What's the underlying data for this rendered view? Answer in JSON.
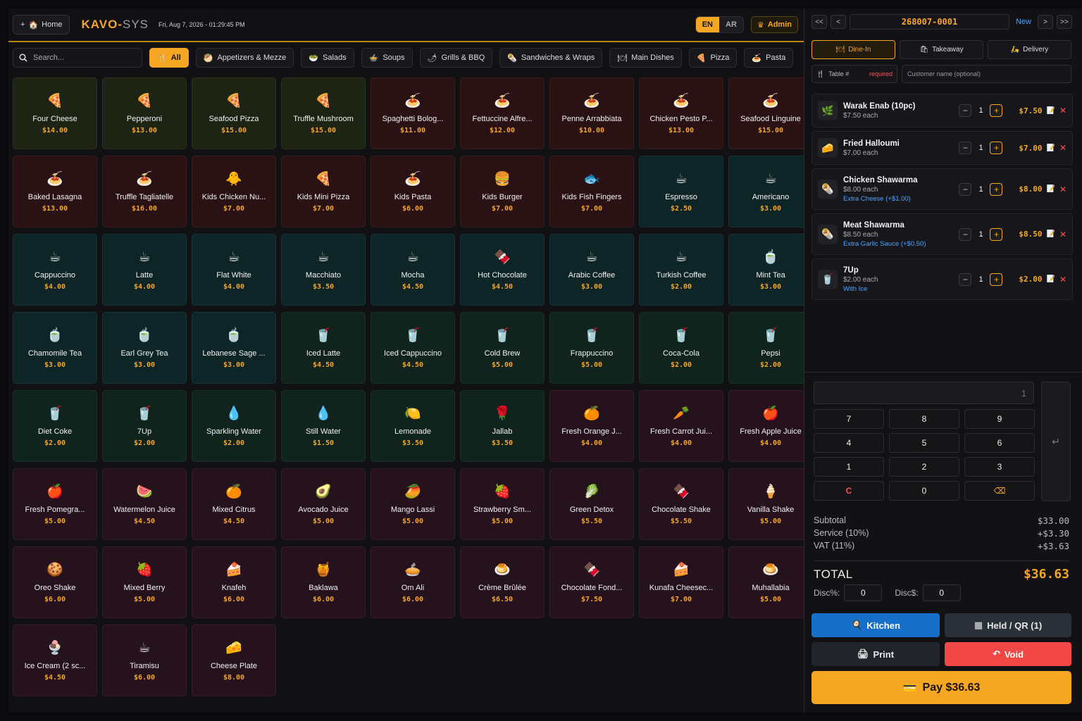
{
  "header": {
    "home_label": "Home",
    "logo_main": "KAVO-",
    "logo_sys": "SYS",
    "datetime": "Fri, Aug 7, 2026 - 01:29:45 PM",
    "lang_en": "EN",
    "lang_ar": "AR",
    "admin_label": "Admin"
  },
  "search": {
    "placeholder": "Search..."
  },
  "categories": [
    {
      "icon": "🍴",
      "label": "All",
      "active": true
    },
    {
      "icon": "🥙",
      "label": "Appetizers & Mezze"
    },
    {
      "icon": "🥗",
      "label": "Salads"
    },
    {
      "icon": "🍲",
      "label": "Soups"
    },
    {
      "icon": "🌶",
      "label": "Grills & BBQ"
    },
    {
      "icon": "🌯",
      "label": "Sandwiches & Wraps"
    },
    {
      "icon": "🍽",
      "label": "Main Dishes"
    },
    {
      "icon": "🍕",
      "label": "Pizza"
    },
    {
      "icon": "🍝",
      "label": "Pasta"
    }
  ],
  "products": [
    {
      "icon": "🍕",
      "name": "Four Cheese",
      "price": "$14.00",
      "tone": "olive"
    },
    {
      "icon": "🍕",
      "name": "Pepperoni",
      "price": "$13.00",
      "tone": "olive"
    },
    {
      "icon": "🍕",
      "name": "Seafood Pizza",
      "price": "$15.00",
      "tone": "olive"
    },
    {
      "icon": "🍕",
      "name": "Truffle Mushroom",
      "price": "$15.00",
      "tone": "olive"
    },
    {
      "icon": "🍝",
      "name": "Spaghetti Bolog...",
      "price": "$11.00",
      "tone": "maroon"
    },
    {
      "icon": "🍝",
      "name": "Fettuccine Alfre...",
      "price": "$12.00",
      "tone": "maroon"
    },
    {
      "icon": "🍝",
      "name": "Penne Arrabbiata",
      "price": "$10.00",
      "tone": "maroon"
    },
    {
      "icon": "🍝",
      "name": "Chicken Pesto P...",
      "price": "$13.00",
      "tone": "maroon"
    },
    {
      "icon": "🍝",
      "name": "Seafood Linguine",
      "price": "$15.00",
      "tone": "maroon"
    },
    {
      "icon": "🍝",
      "name": "Baked Lasagna",
      "price": "$13.00",
      "tone": "maroon"
    },
    {
      "icon": "🍝",
      "name": "Truffle Tagliatelle",
      "price": "$16.00",
      "tone": "maroon"
    },
    {
      "icon": "🐥",
      "name": "Kids Chicken Nu...",
      "price": "$7.00",
      "tone": "maroon"
    },
    {
      "icon": "🍕",
      "name": "Kids Mini Pizza",
      "price": "$7.00",
      "tone": "maroon"
    },
    {
      "icon": "🍝",
      "name": "Kids Pasta",
      "price": "$6.00",
      "tone": "maroon"
    },
    {
      "icon": "🍔",
      "name": "Kids Burger",
      "price": "$7.00",
      "tone": "maroon"
    },
    {
      "icon": "🐟",
      "name": "Kids Fish Fingers",
      "price": "$7.00",
      "tone": "maroon"
    },
    {
      "icon": "☕",
      "name": "Espresso",
      "price": "$2.50",
      "tone": "teal"
    },
    {
      "icon": "☕",
      "name": "Americano",
      "price": "$3.00",
      "tone": "teal"
    },
    {
      "icon": "☕",
      "name": "Cappuccino",
      "price": "$4.00",
      "tone": "teal"
    },
    {
      "icon": "☕",
      "name": "Latte",
      "price": "$4.00",
      "tone": "teal"
    },
    {
      "icon": "☕",
      "name": "Flat White",
      "price": "$4.00",
      "tone": "teal"
    },
    {
      "icon": "☕",
      "name": "Macchiato",
      "price": "$3.50",
      "tone": "teal"
    },
    {
      "icon": "☕",
      "name": "Mocha",
      "price": "$4.50",
      "tone": "teal"
    },
    {
      "icon": "🍫",
      "name": "Hot Chocolate",
      "price": "$4.50",
      "tone": "teal"
    },
    {
      "icon": "☕",
      "name": "Arabic Coffee",
      "price": "$3.00",
      "tone": "teal"
    },
    {
      "icon": "☕",
      "name": "Turkish Coffee",
      "price": "$2.00",
      "tone": "teal"
    },
    {
      "icon": "🍵",
      "name": "Mint Tea",
      "price": "$3.00",
      "tone": "teal"
    },
    {
      "icon": "🍵",
      "name": "Chamomile Tea",
      "price": "$3.00",
      "tone": "teal"
    },
    {
      "icon": "🍵",
      "name": "Earl Grey Tea",
      "price": "$3.00",
      "tone": "teal"
    },
    {
      "icon": "🍵",
      "name": "Lebanese Sage ...",
      "price": "$3.00",
      "tone": "teal"
    },
    {
      "icon": "🥤",
      "name": "Iced Latte",
      "price": "$4.50",
      "tone": "green"
    },
    {
      "icon": "🥤",
      "name": "Iced Cappuccino",
      "price": "$4.50",
      "tone": "green"
    },
    {
      "icon": "🥤",
      "name": "Cold Brew",
      "price": "$5.00",
      "tone": "green"
    },
    {
      "icon": "🥤",
      "name": "Frappuccino",
      "price": "$5.00",
      "tone": "green"
    },
    {
      "icon": "🥤",
      "name": "Coca-Cola",
      "price": "$2.00",
      "tone": "green"
    },
    {
      "icon": "🥤",
      "name": "Pepsi",
      "price": "$2.00",
      "tone": "green"
    },
    {
      "icon": "🥤",
      "name": "Diet Coke",
      "price": "$2.00",
      "tone": "green"
    },
    {
      "icon": "🥤",
      "name": "7Up",
      "price": "$2.00",
      "tone": "green"
    },
    {
      "icon": "💧",
      "name": "Sparkling Water",
      "price": "$2.00",
      "tone": "green"
    },
    {
      "icon": "💧",
      "name": "Still Water",
      "price": "$1.50",
      "tone": "green"
    },
    {
      "icon": "🍋",
      "name": "Lemonade",
      "price": "$3.50",
      "tone": "green"
    },
    {
      "icon": "🌹",
      "name": "Jallab",
      "price": "$3.50",
      "tone": "green"
    },
    {
      "icon": "🍊",
      "name": "Fresh Orange J...",
      "price": "$4.00",
      "tone": "plum"
    },
    {
      "icon": "🥕",
      "name": "Fresh Carrot Jui...",
      "price": "$4.00",
      "tone": "plum"
    },
    {
      "icon": "🍎",
      "name": "Fresh Apple Juice",
      "price": "$4.00",
      "tone": "plum"
    },
    {
      "icon": "🍎",
      "name": "Fresh Pomegra...",
      "price": "$5.00",
      "tone": "plum"
    },
    {
      "icon": "🍉",
      "name": "Watermelon Juice",
      "price": "$4.50",
      "tone": "plum"
    },
    {
      "icon": "🍊",
      "name": "Mixed Citrus",
      "price": "$4.50",
      "tone": "plum"
    },
    {
      "icon": "🥑",
      "name": "Avocado Juice",
      "price": "$5.00",
      "tone": "plum"
    },
    {
      "icon": "🥭",
      "name": "Mango Lassi",
      "price": "$5.00",
      "tone": "plum"
    },
    {
      "icon": "🍓",
      "name": "Strawberry Sm...",
      "price": "$5.00",
      "tone": "plum"
    },
    {
      "icon": "🥬",
      "name": "Green Detox",
      "price": "$5.50",
      "tone": "plum"
    },
    {
      "icon": "🍫",
      "name": "Chocolate Shake",
      "price": "$5.50",
      "tone": "plum"
    },
    {
      "icon": "🍦",
      "name": "Vanilla Shake",
      "price": "$5.00",
      "tone": "plum"
    },
    {
      "icon": "🍪",
      "name": "Oreo Shake",
      "price": "$6.00",
      "tone": "plum"
    },
    {
      "icon": "🍓",
      "name": "Mixed Berry",
      "price": "$5.00",
      "tone": "plum"
    },
    {
      "icon": "🍰",
      "name": "Knafeh",
      "price": "$6.00",
      "tone": "plum"
    },
    {
      "icon": "🍯",
      "name": "Baklawa",
      "price": "$6.00",
      "tone": "plum"
    },
    {
      "icon": "🥧",
      "name": "Om Ali",
      "price": "$6.00",
      "tone": "plum"
    },
    {
      "icon": "🍮",
      "name": "Crème Brûlée",
      "price": "$6.50",
      "tone": "plum"
    },
    {
      "icon": "🍫",
      "name": "Chocolate Fond...",
      "price": "$7.50",
      "tone": "plum"
    },
    {
      "icon": "🍰",
      "name": "Kunafa Cheesec...",
      "price": "$7.00",
      "tone": "plum"
    },
    {
      "icon": "🍮",
      "name": "Muhallabia",
      "price": "$5.00",
      "tone": "plum"
    },
    {
      "icon": "🍨",
      "name": "Ice Cream (2 sc...",
      "price": "$4.50",
      "tone": "plum"
    },
    {
      "icon": "☕",
      "name": "Tiramisu",
      "price": "$6.00",
      "tone": "plum"
    },
    {
      "icon": "🧀",
      "name": "Cheese Plate",
      "price": "$8.00",
      "tone": "plum"
    }
  ],
  "order": {
    "nav_first": "<<",
    "nav_prev": "<",
    "number": "268007-0001",
    "new_label": "New",
    "nav_next": ">",
    "nav_last": ">>",
    "types": [
      {
        "icon": "🍽",
        "label": "Dine-In",
        "active": true
      },
      {
        "icon": "🛍",
        "label": "Takeaway"
      },
      {
        "icon": "🛵",
        "label": "Delivery"
      }
    ],
    "table_label": "Table #",
    "table_required": "required",
    "customer_placeholder": "Customer name (optional)",
    "lines": [
      {
        "icon": "🌿",
        "name": "Warak Enab (10pc)",
        "each": "$7.50 each",
        "modifier": "",
        "qty": "1",
        "total": "$7.50"
      },
      {
        "icon": "🧀",
        "name": "Fried Halloumi",
        "each": "$7.00 each",
        "modifier": "",
        "qty": "1",
        "total": "$7.00"
      },
      {
        "icon": "🌯",
        "name": "Chicken Shawarma",
        "each": "$8.00 each",
        "modifier": "Extra Cheese (+$1.00)",
        "qty": "1",
        "total": "$8.00"
      },
      {
        "icon": "🌯",
        "name": "Meat Shawarma",
        "each": "$8.50 each",
        "modifier": "Extra Garlic Sauce (+$0.50)",
        "qty": "1",
        "total": "$8.50"
      },
      {
        "icon": "🥤",
        "name": "7Up",
        "each": "$2.00 each",
        "modifier": "With Ice",
        "qty": "1",
        "total": "$2.00"
      }
    ]
  },
  "keypad": {
    "display": "1",
    "keys": [
      "7",
      "8",
      "9",
      "4",
      "5",
      "6",
      "1",
      "2",
      "3",
      "C",
      "0",
      "⌫"
    ],
    "enter": "↵"
  },
  "totals": {
    "subtotal_label": "Subtotal",
    "subtotal": "$33.00",
    "service_label": "Service (10%)",
    "service": "+$3.30",
    "vat_label": "VAT (11%)",
    "vat": "+$3.63",
    "total_label": "TOTAL",
    "total": "$36.63",
    "disc_pct_label": "Disc%:",
    "disc_pct": "0",
    "disc_amt_label": "Disc$:",
    "disc_amt": "0"
  },
  "actions": {
    "kitchen": "Kitchen",
    "held": "Held / QR (1)",
    "print": "Print",
    "void": "Void",
    "pay": "Pay $36.63"
  },
  "colors": {
    "accent": "#f5a623",
    "kitchen": "#1670c9",
    "void": "#f24747",
    "link": "#4aa3ff"
  }
}
